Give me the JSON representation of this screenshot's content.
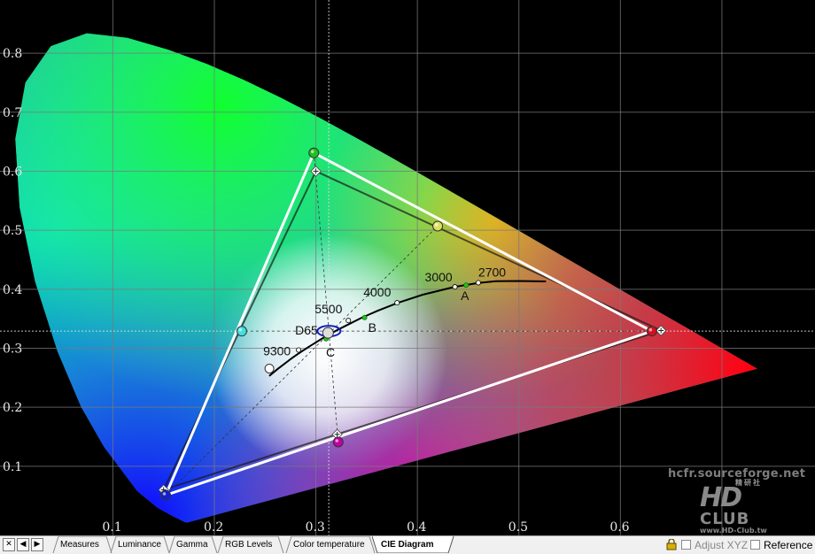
{
  "chart_data": {
    "type": "scatter",
    "title": "",
    "xlabel": "",
    "ylabel": "",
    "xlim": [
      0.0,
      0.79
    ],
    "ylim": [
      0.0,
      0.86
    ],
    "grid": true,
    "x_ticks": [
      0.1,
      0.2,
      0.3,
      0.4,
      0.5,
      0.6
    ],
    "y_ticks": [
      0.1,
      0.2,
      0.3,
      0.4,
      0.5,
      0.6,
      0.7,
      0.8
    ],
    "reference_gamut": {
      "red": [
        0.64,
        0.33
      ],
      "green": [
        0.3,
        0.6
      ],
      "blue": [
        0.15,
        0.06
      ]
    },
    "measured_gamut": {
      "red": [
        0.631,
        0.329
      ],
      "green": [
        0.298,
        0.631
      ],
      "blue": [
        0.152,
        0.051
      ]
    },
    "secondary_targets": {
      "yellow": [
        0.419,
        0.505
      ],
      "cyan": [
        0.225,
        0.329
      ],
      "magenta": [
        0.321,
        0.154
      ]
    },
    "secondary_measured": {
      "yellow": [
        0.42,
        0.507
      ],
      "cyan": [
        0.227,
        0.329
      ],
      "magenta": [
        0.322,
        0.141
      ]
    },
    "white_point_measured": [
      0.312,
      0.329
    ],
    "crosshair": [
      0.3127,
      0.329
    ],
    "planckian_labels": [
      {
        "text": "2700",
        "x": 0.46,
        "y": 0.411
      },
      {
        "text": "3000",
        "x": 0.437,
        "y": 0.404
      },
      {
        "text": "4000",
        "x": 0.38,
        "y": 0.377
      },
      {
        "text": "5500",
        "x": 0.332,
        "y": 0.347
      },
      {
        "text": "9300",
        "x": 0.283,
        "y": 0.297
      }
    ],
    "illuminants": [
      {
        "text": "A",
        "x": 0.448,
        "y": 0.407
      },
      {
        "text": "B",
        "x": 0.348,
        "y": 0.352
      },
      {
        "text": "C",
        "x": 0.31,
        "y": 0.316
      },
      {
        "text": "D65",
        "x": 0.3127,
        "y": 0.329
      }
    ]
  },
  "watermark": {
    "site": "hcfr.sourceforge.net",
    "logo_big": "HD",
    "logo_club": "CLUB",
    "logo_domain": "www.HD-Club.tw",
    "logo_cjk": "精研社"
  },
  "tabs": [
    {
      "label": "Measures",
      "active": false
    },
    {
      "label": "Luminance",
      "active": false
    },
    {
      "label": "Gamma",
      "active": false
    },
    {
      "label": "RGB Levels",
      "active": false
    },
    {
      "label": "Color temperature",
      "active": false
    },
    {
      "label": "CIE Diagram",
      "active": true
    }
  ],
  "nav_buttons": [
    "✕",
    "◀",
    "▶"
  ],
  "options": {
    "adjust_xyz": "Adjust XYZ",
    "reference": "Reference"
  },
  "colors": {
    "gamut_line": "#ffffff",
    "ref_line": "#1a1a1a",
    "grid": "#7a7a7a"
  }
}
